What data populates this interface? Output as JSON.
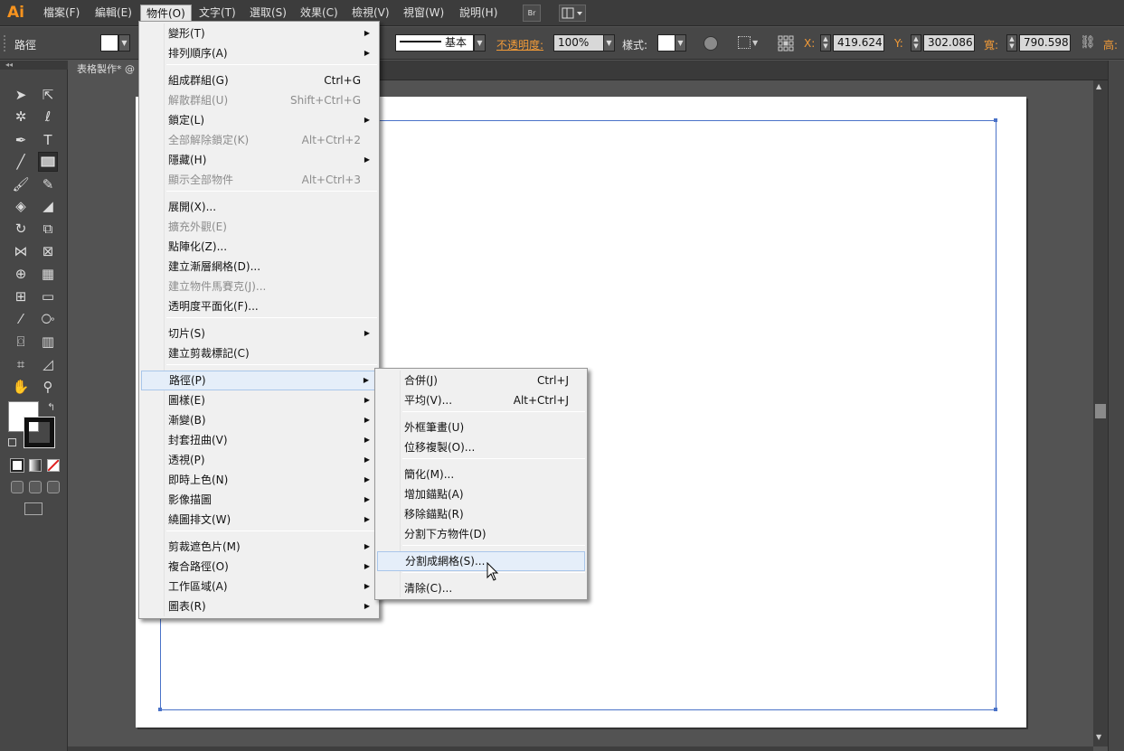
{
  "app": {
    "logo": "Ai"
  },
  "menubar": {
    "items": [
      "檔案(F)",
      "編輯(E)",
      "物件(O)",
      "文字(T)",
      "選取(S)",
      "效果(C)",
      "檢視(V)",
      "視窗(W)",
      "說明(H)"
    ],
    "bridge_icon": "Br"
  },
  "control": {
    "selection_type": "路徑",
    "stroke_style": "基本",
    "opacity_label": "不透明度:",
    "opacity_value": "100%",
    "style_label": "樣式:",
    "x_label": "X:",
    "x_value": "419.624",
    "y_label": "Y:",
    "y_value": "302.086",
    "w_label": "寬:",
    "w_value": "790.598",
    "h_label": "高:"
  },
  "document": {
    "tab_title": "表格製作*  @"
  },
  "object_menu": [
    {
      "label": "變形(T)",
      "shortcut": "",
      "submenu": true,
      "disabled": false
    },
    {
      "label": "排列順序(A)",
      "shortcut": "",
      "submenu": true,
      "disabled": false
    },
    {
      "label": "組成群組(G)",
      "shortcut": "Ctrl+G",
      "submenu": false,
      "disabled": false
    },
    {
      "label": "解散群組(U)",
      "shortcut": "Shift+Ctrl+G",
      "submenu": false,
      "disabled": true
    },
    {
      "label": "鎖定(L)",
      "shortcut": "",
      "submenu": true,
      "disabled": false
    },
    {
      "label": "全部解除鎖定(K)",
      "shortcut": "Alt+Ctrl+2",
      "submenu": false,
      "disabled": true
    },
    {
      "label": "隱藏(H)",
      "shortcut": "",
      "submenu": true,
      "disabled": false
    },
    {
      "label": "顯示全部物件",
      "shortcut": "Alt+Ctrl+3",
      "submenu": false,
      "disabled": true
    },
    {
      "label": "展開(X)...",
      "shortcut": "",
      "submenu": false,
      "disabled": false
    },
    {
      "label": "擴充外觀(E)",
      "shortcut": "",
      "submenu": false,
      "disabled": true
    },
    {
      "label": "點陣化(Z)...",
      "shortcut": "",
      "submenu": false,
      "disabled": false
    },
    {
      "label": "建立漸層網格(D)...",
      "shortcut": "",
      "submenu": false,
      "disabled": false
    },
    {
      "label": "建立物件馬賽克(J)...",
      "shortcut": "",
      "submenu": false,
      "disabled": true
    },
    {
      "label": "透明度平面化(F)...",
      "shortcut": "",
      "submenu": false,
      "disabled": false
    },
    {
      "label": "切片(S)",
      "shortcut": "",
      "submenu": true,
      "disabled": false
    },
    {
      "label": "建立剪裁標記(C)",
      "shortcut": "",
      "submenu": false,
      "disabled": false
    },
    {
      "label": "路徑(P)",
      "shortcut": "",
      "submenu": true,
      "disabled": false
    },
    {
      "label": "圖樣(E)",
      "shortcut": "",
      "submenu": true,
      "disabled": false
    },
    {
      "label": "漸變(B)",
      "shortcut": "",
      "submenu": true,
      "disabled": false
    },
    {
      "label": "封套扭曲(V)",
      "shortcut": "",
      "submenu": true,
      "disabled": false
    },
    {
      "label": "透視(P)",
      "shortcut": "",
      "submenu": true,
      "disabled": false
    },
    {
      "label": "即時上色(N)",
      "shortcut": "",
      "submenu": true,
      "disabled": false
    },
    {
      "label": "影像描圖",
      "shortcut": "",
      "submenu": true,
      "disabled": false
    },
    {
      "label": "繞圖排文(W)",
      "shortcut": "",
      "submenu": true,
      "disabled": false
    },
    {
      "label": "剪裁遮色片(M)",
      "shortcut": "",
      "submenu": true,
      "disabled": false
    },
    {
      "label": "複合路徑(O)",
      "shortcut": "",
      "submenu": true,
      "disabled": false
    },
    {
      "label": "工作區域(A)",
      "shortcut": "",
      "submenu": true,
      "disabled": false
    },
    {
      "label": "圖表(R)",
      "shortcut": "",
      "submenu": true,
      "disabled": false
    }
  ],
  "path_submenu": [
    {
      "label": "合併(J)",
      "shortcut": "Ctrl+J"
    },
    {
      "label": "平均(V)...",
      "shortcut": "Alt+Ctrl+J"
    },
    {
      "label": "外框筆畫(U)",
      "shortcut": ""
    },
    {
      "label": "位移複製(O)...",
      "shortcut": ""
    },
    {
      "label": "簡化(M)...",
      "shortcut": ""
    },
    {
      "label": "增加錨點(A)",
      "shortcut": ""
    },
    {
      "label": "移除錨點(R)",
      "shortcut": ""
    },
    {
      "label": "分割下方物件(D)",
      "shortcut": ""
    },
    {
      "label": "分割成網格(S)...",
      "shortcut": ""
    },
    {
      "label": "清除(C)...",
      "shortcut": ""
    }
  ],
  "colors": {
    "selection_blue": "#4a72c8",
    "ui_orange": "#f29b38",
    "menu_bg": "#f0f0f0"
  }
}
